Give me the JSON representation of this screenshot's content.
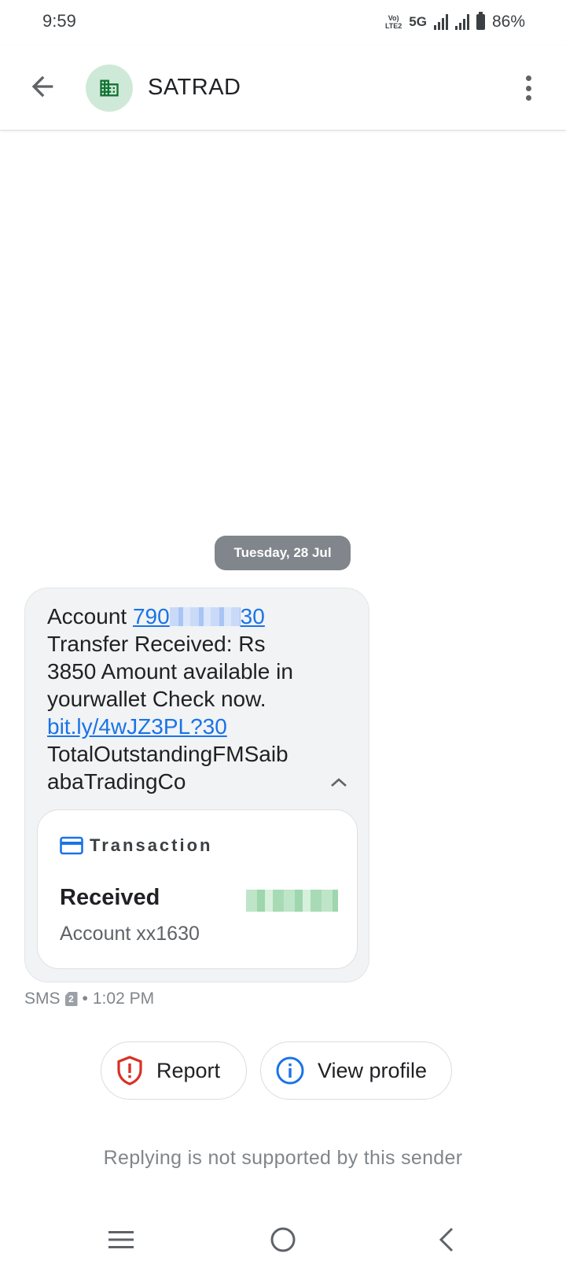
{
  "status_bar": {
    "time": "9:59",
    "volte_label": "VoLTE2",
    "network": "5G",
    "battery": "86%"
  },
  "header": {
    "back_icon": "arrow-back-icon",
    "avatar_icon": "business-building-icon",
    "avatar_color": "#cfe9d9",
    "title": "SATRAD",
    "more_icon": "more-vert-icon"
  },
  "conversation": {
    "date_chip": "Tuesday, 28 Jul",
    "message": {
      "account_prefix": "Account ",
      "account_link_start": "790",
      "account_link_end": "30",
      "line_transfer": "Transfer Received: Rs",
      "line_amount": "3850 Amount available in",
      "line_wallet": "yourwallet Check now.",
      "url": "bit.ly/4wJZ3PL?30",
      "line_outstanding": "TotalOutstandingFMSaib",
      "line_company": "abaTradingCo"
    },
    "transaction": {
      "label": "Transaction",
      "status": "Received",
      "account": "Account xx1630"
    },
    "meta": {
      "channel": "SMS",
      "sim": "2",
      "separator": "•",
      "time": "1:02 PM"
    }
  },
  "actions": {
    "report": "Report",
    "view_profile": "View profile"
  },
  "reply_note": "Replying is not supported by this sender",
  "colors": {
    "link": "#1a73e8",
    "report_icon": "#d93025",
    "info_icon": "#1a73e8"
  }
}
